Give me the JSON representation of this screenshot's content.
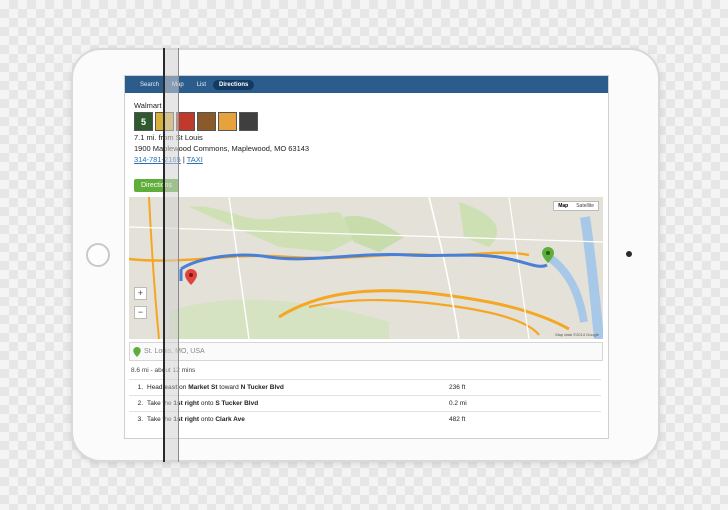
{
  "tabs": [
    {
      "label": "Search",
      "active": false
    },
    {
      "label": "Map",
      "active": false
    },
    {
      "label": "List",
      "active": false
    },
    {
      "label": "Directions",
      "active": true
    }
  ],
  "store": {
    "name": "Walmart",
    "distance_line": "7.1 mi. from St Louis",
    "address": "1900 Maplewood Commons, Maplewood, MO 63143",
    "phone": "314-781-2165",
    "separator": "|",
    "taxi": "TAXI",
    "logo_badge": "5"
  },
  "directions_button": "Directions",
  "map": {
    "toggle": [
      "Map",
      "Satellite"
    ],
    "active_toggle": "Map",
    "zoom_in": "+",
    "zoom_out": "−",
    "credit": "Map data ©2014 Google",
    "route_color": "#4a7fd6",
    "highway_color": "#f5a623"
  },
  "start": {
    "text": "St. Louis, MO, USA",
    "pin_color": "#5fae3a"
  },
  "summary": "8.6 mi - about 12 mins",
  "steps": [
    {
      "num": "1.",
      "pre": "Head ",
      "b1": "east",
      "mid": " on ",
      "b2": "Market St",
      "mid2": " toward ",
      "b3": "N Tucker Blvd",
      "dist": "236 ft"
    },
    {
      "num": "2.",
      "pre": "Take the ",
      "b1": "1st",
      "mid": " ",
      "b2": "right",
      "mid2": " onto ",
      "b3": "S Tucker Blvd",
      "dist": "0.2 mi"
    },
    {
      "num": "3.",
      "pre": "Take the ",
      "b1": "1st",
      "mid": " ",
      "b2": "right",
      "mid2": " onto ",
      "b3": "Clark Ave",
      "dist": "482 ft"
    }
  ]
}
